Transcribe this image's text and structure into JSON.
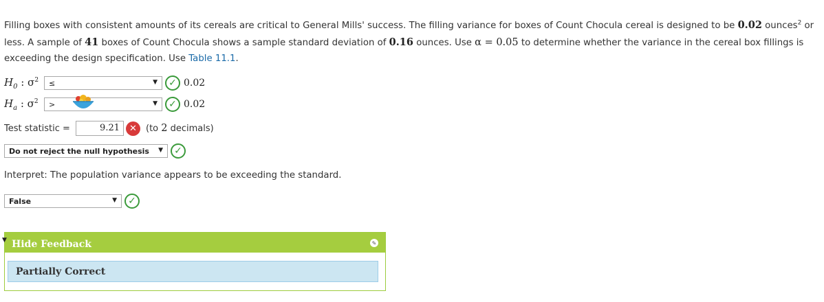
{
  "question": {
    "p1": "Filling boxes with consistent amounts of its cereals are critical to General Mills' success. The filling variance for boxes of Count Chocula cereal is designed to be ",
    "design_value": "0.02",
    "p2": " ounces",
    "p2_sup": "2",
    "p3": " or less. A sample of ",
    "n": "41",
    "p4": " boxes of Count Chocula shows a sample standard deviation of ",
    "s": "0.16",
    "p5": " ounces. Use ",
    "alpha_expr": "α = 0.05",
    "p6": " to determine whether the variance in the cereal box fillings is exceeding the design specification. Use ",
    "table_link": "Table 11.1",
    "p7": "."
  },
  "hypotheses": {
    "h0": {
      "label_main": "H",
      "sub": "0",
      "colon": " : σ",
      "sup": "2",
      "select_value": "≤",
      "value": "0.02"
    },
    "ha": {
      "label_main": "H",
      "sub": "a",
      "colon": " : σ",
      "sup": "2",
      "select_value": ">",
      "value": "0.02"
    }
  },
  "test_statistic": {
    "label": "Test statistic =",
    "value": "9.21",
    "hint_pre": "(to ",
    "hint_num": "2",
    "hint_post": " decimals)"
  },
  "decision": {
    "select_value": "Do not reject the null hypothesis"
  },
  "interpret": {
    "text": "Interpret: The population variance appears to be exceeding the standard."
  },
  "truth": {
    "select_value": "False"
  },
  "feedback": {
    "toggle_label": "Hide Feedback",
    "message": "Partially Correct"
  },
  "colors": {
    "correct": "#3a9a3a",
    "incorrect": "#d83a3a",
    "feedback_header": "#a5cd3f",
    "feedback_body": "#cce6f2"
  }
}
